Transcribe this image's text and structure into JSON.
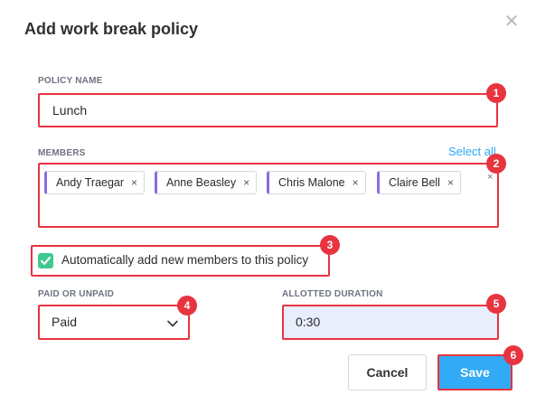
{
  "dialog": {
    "title": "Add work break policy",
    "close_glyph": "✕"
  },
  "policy_name": {
    "label": "POLICY NAME",
    "value": "Lunch"
  },
  "members": {
    "label": "MEMBERS",
    "select_all": "Select all",
    "clear_glyph": "×",
    "items": [
      {
        "name": "Andy Traegar",
        "remove": "×"
      },
      {
        "name": "Anne Beasley",
        "remove": "×"
      },
      {
        "name": "Chris Malone",
        "remove": "×"
      },
      {
        "name": "Claire Bell",
        "remove": "×"
      }
    ],
    "tag_accent": "#8a6be0"
  },
  "auto_add": {
    "label": "Automatically add new members to this policy",
    "checked": true,
    "check_color": "#3ec98e"
  },
  "paid": {
    "label": "PAID OR UNPAID",
    "value": "Paid",
    "icon": "chevron-down-icon"
  },
  "duration": {
    "label": "ALLOTTED DURATION",
    "value": "0:30"
  },
  "buttons": {
    "cancel": "Cancel",
    "save": "Save"
  },
  "annotations": [
    "1",
    "2",
    "3",
    "4",
    "5",
    "6"
  ],
  "colors": {
    "highlight": "#e8343f",
    "accent": "#32aaf5",
    "link": "#2aa7f4"
  }
}
